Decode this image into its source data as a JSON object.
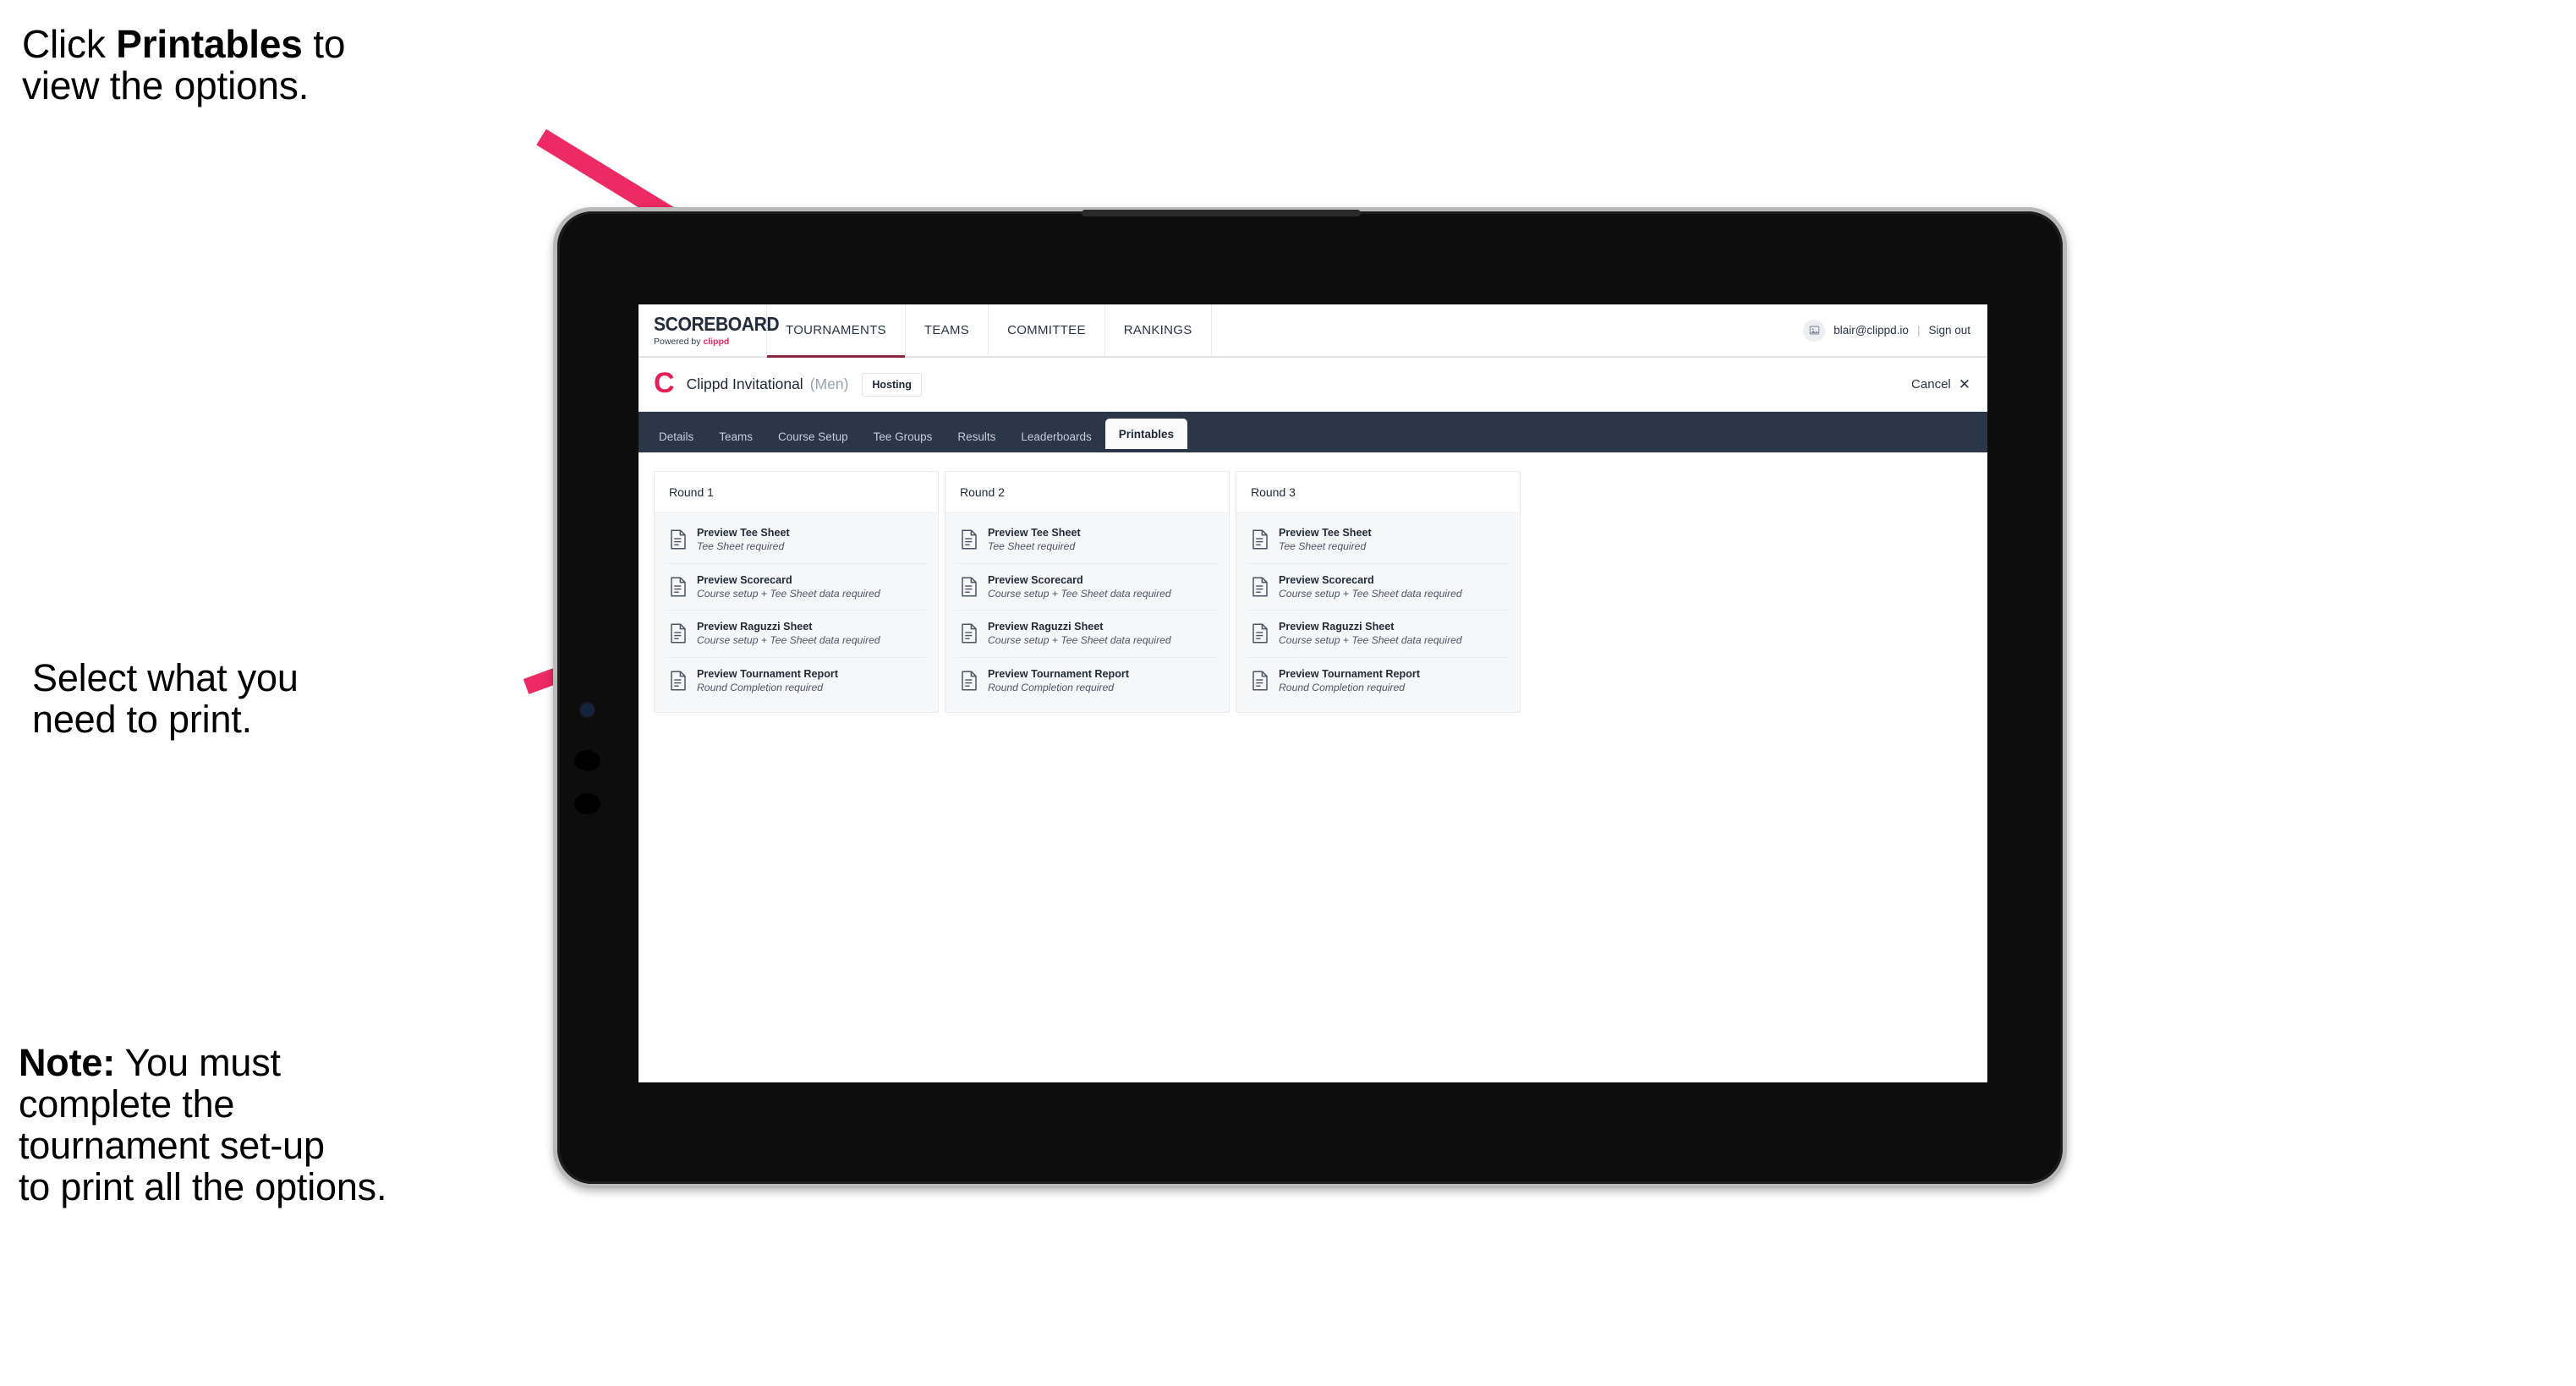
{
  "annotations": {
    "step1_prefix": "Click ",
    "step1_bold": "Printables",
    "step1_suffix": " to\nview the options.",
    "step2": "Select what you\n need to print.",
    "step3_bold": "Note:",
    "step3_rest": " You must\ncomplete the\ntournament set-up\nto print all the options."
  },
  "colors": {
    "accent_pink": "#ea2a63",
    "arrow_pink": "#ed2a63",
    "tabstrip_navy": "#2b3649",
    "nav_active_underline": "#8c2541"
  },
  "browser": {
    "topnav": {
      "brand_title": "SCOREBOARD",
      "brand_sub_prefix": "Powered by ",
      "brand_sub_word": "clippd",
      "items": [
        {
          "label": "TOURNAMENTS",
          "active": true
        },
        {
          "label": "TEAMS",
          "active": false
        },
        {
          "label": "COMMITTEE",
          "active": false
        },
        {
          "label": "RANKINGS",
          "active": false
        }
      ],
      "avatar_icon": "user-avatar-icon",
      "user_email": "blair@clippd.io",
      "separator": "|",
      "sign_out": "Sign out"
    },
    "tournament_bar": {
      "logo_letter": "C",
      "name": "Clippd Invitational",
      "gender": "(Men)",
      "badge": "Hosting",
      "cancel_label": "Cancel",
      "cancel_icon": "✕"
    },
    "tabs": [
      {
        "label": "Details",
        "active": false
      },
      {
        "label": "Teams",
        "active": false
      },
      {
        "label": "Course Setup",
        "active": false
      },
      {
        "label": "Tee Groups",
        "active": false
      },
      {
        "label": "Results",
        "active": false
      },
      {
        "label": "Leaderboards",
        "active": false
      },
      {
        "label": "Printables",
        "active": true
      }
    ],
    "rounds": [
      {
        "title": "Round 1",
        "items": [
          {
            "title": "Preview Tee Sheet",
            "sub": "Tee Sheet required"
          },
          {
            "title": "Preview Scorecard",
            "sub": "Course setup + Tee Sheet data required"
          },
          {
            "title": "Preview Raguzzi Sheet",
            "sub": "Course setup + Tee Sheet data required"
          },
          {
            "title": "Preview Tournament Report",
            "sub": "Round Completion required"
          }
        ]
      },
      {
        "title": "Round 2",
        "items": [
          {
            "title": "Preview Tee Sheet",
            "sub": "Tee Sheet required"
          },
          {
            "title": "Preview Scorecard",
            "sub": "Course setup + Tee Sheet data required"
          },
          {
            "title": "Preview Raguzzi Sheet",
            "sub": "Course setup + Tee Sheet data required"
          },
          {
            "title": "Preview Tournament Report",
            "sub": "Round Completion required"
          }
        ]
      },
      {
        "title": "Round 3",
        "items": [
          {
            "title": "Preview Tee Sheet",
            "sub": "Tee Sheet required"
          },
          {
            "title": "Preview Scorecard",
            "sub": "Course setup + Tee Sheet data required"
          },
          {
            "title": "Preview Raguzzi Sheet",
            "sub": "Course setup + Tee Sheet data required"
          },
          {
            "title": "Preview Tournament Report",
            "sub": "Round Completion required"
          }
        ]
      }
    ]
  }
}
